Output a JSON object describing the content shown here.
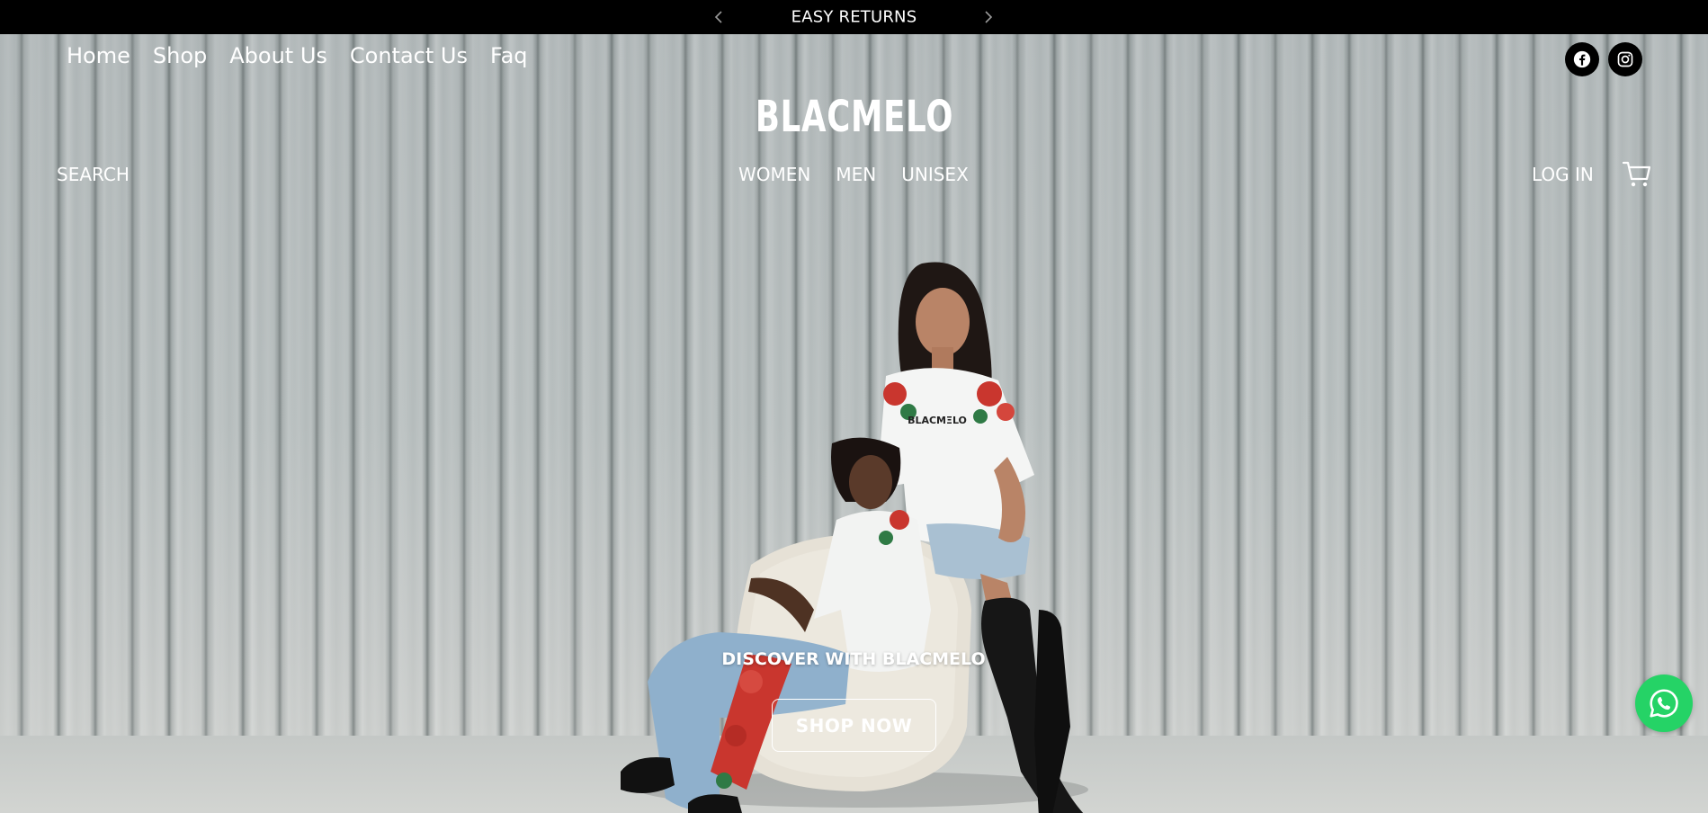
{
  "announcement": {
    "text": "EASY RETURNS",
    "prev_icon": "chevron-left-icon",
    "next_icon": "chevron-right-icon"
  },
  "top_nav": {
    "items": [
      "Home",
      "Shop",
      "About Us",
      "Contact Us",
      "Faq"
    ]
  },
  "social": {
    "facebook_icon": "facebook-icon",
    "instagram_icon": "instagram-icon"
  },
  "logo": {
    "text": "BLACMELO"
  },
  "header": {
    "search_label": "SEARCH",
    "categories": [
      "WOMEN",
      "MEN",
      "UNISEX"
    ],
    "login_label": "LOG IN",
    "cart_icon": "cart-icon"
  },
  "hero": {
    "title": "DISCOVER WITH BLACMELO",
    "cta_label": "SHOP NOW"
  },
  "whatsapp": {
    "icon": "whatsapp-icon",
    "color": "#25d366"
  },
  "colors": {
    "announcement_bg": "#000000",
    "text_on_hero": "#ffffff",
    "hero_bg": "#b5bcbc"
  }
}
